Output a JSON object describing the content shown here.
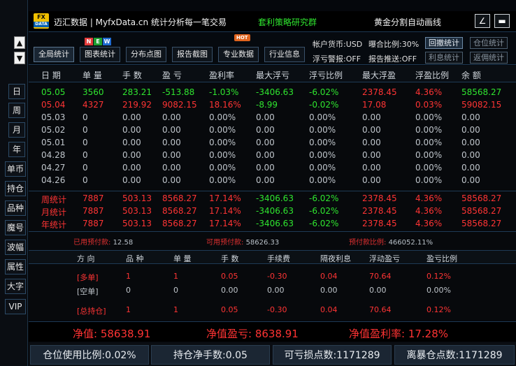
{
  "sidebar": {
    "scroll_up": "▲",
    "scroll_down": "▼",
    "items": [
      "日",
      "周",
      "月",
      "年",
      "单币",
      "持仓",
      "品种",
      "魔号",
      "波幅",
      "属性",
      "大字",
      "VIP"
    ]
  },
  "header": {
    "logo_top": "FX",
    "logo_bottom": "DATA",
    "brand": "迈汇数据 | MyfxData.cn",
    "slogan": "统计分析每一笔交易",
    "group": "套利策略研究群",
    "indicator": "黄金分割自动画线",
    "btn_draw": "∠",
    "btn_min": "▬"
  },
  "toolbar": {
    "new_badge": [
      "N",
      "E",
      "W"
    ],
    "hot_badge": "HOT",
    "buttons": [
      "全局统计",
      "图表统计",
      "分布点图",
      "报告截图",
      "专业数据",
      "行业信息"
    ],
    "account_currency": "帐户货币:USD",
    "exposure_ratio": "曝合比例:30%",
    "float_loss_alert": "浮亏警报:OFF",
    "report_push": "报告推送:OFF",
    "btn_drawdown": "回撤统计",
    "btn_position": "仓位统计",
    "btn_interest": "利息统计",
    "btn_rebate": "返佣统计"
  },
  "table": {
    "headers": [
      "日 期",
      "单 量",
      "手 数",
      "盈 亏",
      "盈利率",
      "最大浮亏",
      "浮亏比例",
      "最大浮盈",
      "浮盈比例",
      "余 额"
    ],
    "rows": [
      {
        "cells": [
          "05.05",
          "3560",
          "283.21",
          "-513.88",
          "-1.03%",
          "-3406.63",
          "-6.02%",
          "2378.45",
          "4.36%",
          "58568.27"
        ],
        "colors": [
          "green",
          "green",
          "green",
          "green",
          "green",
          "green",
          "green",
          "red",
          "red",
          "green"
        ]
      },
      {
        "cells": [
          "05.04",
          "4327",
          "219.92",
          "9082.15",
          "18.16%",
          "-8.99",
          "-0.02%",
          "17.08",
          "0.03%",
          "59082.15"
        ],
        "colors": [
          "red",
          "red",
          "red",
          "red",
          "red",
          "green",
          "green",
          "red",
          "red",
          "red"
        ]
      },
      {
        "cells": [
          "05.03",
          "0",
          "0.00",
          "0.00",
          "0.00%",
          "0.00",
          "0.00%",
          "0.00",
          "0.00%",
          "0.00"
        ],
        "colors": [
          "gray",
          "gray",
          "gray",
          "gray",
          "gray",
          "gray",
          "gray",
          "gray",
          "gray",
          "gray"
        ]
      },
      {
        "cells": [
          "05.02",
          "0",
          "0.00",
          "0.00",
          "0.00%",
          "0.00",
          "0.00%",
          "0.00",
          "0.00%",
          "0.00"
        ],
        "colors": [
          "gray",
          "gray",
          "gray",
          "gray",
          "gray",
          "gray",
          "gray",
          "gray",
          "gray",
          "gray"
        ]
      },
      {
        "cells": [
          "05.01",
          "0",
          "0.00",
          "0.00",
          "0.00%",
          "0.00",
          "0.00%",
          "0.00",
          "0.00%",
          "0.00"
        ],
        "colors": [
          "gray",
          "gray",
          "gray",
          "gray",
          "gray",
          "gray",
          "gray",
          "gray",
          "gray",
          "gray"
        ]
      },
      {
        "cells": [
          "04.28",
          "0",
          "0.00",
          "0.00",
          "0.00%",
          "0.00",
          "0.00%",
          "0.00",
          "0.00%",
          "0.00"
        ],
        "colors": [
          "gray",
          "gray",
          "gray",
          "gray",
          "gray",
          "gray",
          "gray",
          "gray",
          "gray",
          "gray"
        ]
      },
      {
        "cells": [
          "04.27",
          "0",
          "0.00",
          "0.00",
          "0.00%",
          "0.00",
          "0.00%",
          "0.00",
          "0.00%",
          "0.00"
        ],
        "colors": [
          "gray",
          "gray",
          "gray",
          "gray",
          "gray",
          "gray",
          "gray",
          "gray",
          "gray",
          "gray"
        ]
      },
      {
        "cells": [
          "04.26",
          "0",
          "0.00",
          "0.00",
          "0.00%",
          "0.00",
          "0.00%",
          "0.00",
          "0.00%",
          "0.00"
        ],
        "colors": [
          "gray",
          "gray",
          "gray",
          "gray",
          "gray",
          "gray",
          "gray",
          "gray",
          "gray",
          "gray"
        ]
      }
    ],
    "summary": [
      {
        "cells": [
          "周统计",
          "7887",
          "503.13",
          "8568.27",
          "17.14%",
          "-3406.63",
          "-6.02%",
          "2378.45",
          "4.36%",
          "58568.27"
        ],
        "colors": [
          "red",
          "red",
          "red",
          "red",
          "red",
          "green",
          "green",
          "red",
          "red",
          "red"
        ]
      },
      {
        "cells": [
          "月统计",
          "7887",
          "503.13",
          "8568.27",
          "17.14%",
          "-3406.63",
          "-6.02%",
          "2378.45",
          "4.36%",
          "58568.27"
        ],
        "colors": [
          "red",
          "red",
          "red",
          "red",
          "red",
          "green",
          "green",
          "red",
          "red",
          "red"
        ]
      },
      {
        "cells": [
          "年统计",
          "7887",
          "503.13",
          "8568.27",
          "17.14%",
          "-3406.63",
          "-6.02%",
          "2378.45",
          "4.36%",
          "58568.27"
        ],
        "colors": [
          "red",
          "red",
          "red",
          "red",
          "red",
          "green",
          "green",
          "red",
          "red",
          "red"
        ]
      }
    ]
  },
  "payments": {
    "used_label": "已用预付款:",
    "used_value": "12.58",
    "available_label": "可用预付款:",
    "available_value": "58626.33",
    "ratio_label": "预付款比例:",
    "ratio_value": "466052.11%"
  },
  "positions": {
    "headers": [
      "方 向",
      "品 种",
      "单 量",
      "手 数",
      "手续费",
      "隔夜利息",
      "浮动盈亏",
      "盈亏比例"
    ],
    "rows": [
      {
        "cells": [
          "[多单]",
          "1",
          "1",
          "0.05",
          "-0.30",
          "0.04",
          "70.64",
          "0.12%"
        ],
        "color": "red"
      },
      {
        "cells": [
          "[空单]",
          "0",
          "0",
          "0.00",
          "0.00",
          "0.00",
          "0.00",
          "0.00%"
        ],
        "color": "gray"
      },
      {
        "cells": [
          "[总持仓]",
          "1",
          "1",
          "0.05",
          "-0.30",
          "0.04",
          "70.64",
          "0.12%"
        ],
        "color": "red"
      }
    ]
  },
  "equity": {
    "net_value": "净值:  58638.91",
    "net_profit": "净值盈亏:  8638.91",
    "net_rate": "净值盈利率:  17.28%"
  },
  "footer": {
    "usage_ratio": "仓位使用比例:0.02%",
    "net_lots": "持仓净手数:0.05",
    "loss_points": "可亏损点数:1171289",
    "liquidation_points": "离暴仓点数:1171289"
  },
  "colors": {
    "profit": "#ff3434",
    "loss": "#2fe52f",
    "neutral": "#bfc5cb",
    "accent_green": "#2fe52f",
    "border": "#1e3a55"
  }
}
